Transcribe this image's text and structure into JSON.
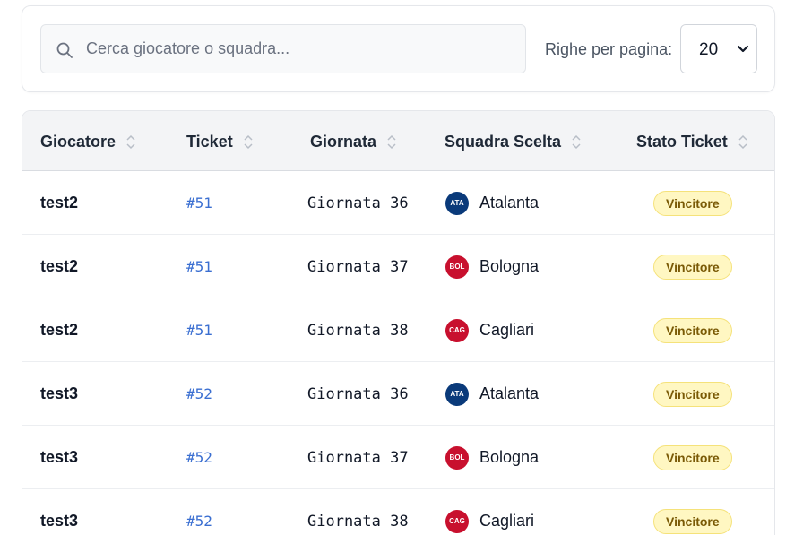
{
  "search": {
    "placeholder": "Cerca giocatore o squadra..."
  },
  "pagination": {
    "rows_label": "Righe per pagina:",
    "rows_value": "20"
  },
  "table": {
    "columns": [
      "Giocatore",
      "Ticket",
      "Giornata",
      "Squadra Scelta",
      "Stato Ticket"
    ],
    "rows": [
      {
        "player": "test2",
        "ticket": "#51",
        "round": "Giornata 36",
        "team": {
          "name": "Atalanta",
          "abbr": "ATA",
          "color": "#0a3a7a"
        },
        "status": "Vincitore"
      },
      {
        "player": "test2",
        "ticket": "#51",
        "round": "Giornata 37",
        "team": {
          "name": "Bologna",
          "abbr": "BOL",
          "color": "#c8102e"
        },
        "status": "Vincitore"
      },
      {
        "player": "test2",
        "ticket": "#51",
        "round": "Giornata 38",
        "team": {
          "name": "Cagliari",
          "abbr": "CAG",
          "color": "#c8102e"
        },
        "status": "Vincitore"
      },
      {
        "player": "test3",
        "ticket": "#52",
        "round": "Giornata 36",
        "team": {
          "name": "Atalanta",
          "abbr": "ATA",
          "color": "#0a3a7a"
        },
        "status": "Vincitore"
      },
      {
        "player": "test3",
        "ticket": "#52",
        "round": "Giornata 37",
        "team": {
          "name": "Bologna",
          "abbr": "BOL",
          "color": "#c8102e"
        },
        "status": "Vincitore"
      },
      {
        "player": "test3",
        "ticket": "#52",
        "round": "Giornata 38",
        "team": {
          "name": "Cagliari",
          "abbr": "CAG",
          "color": "#c8102e"
        },
        "status": "Vincitore"
      }
    ]
  },
  "colors": {
    "link": "#3b6fd1",
    "status_bg": "#fff7c2",
    "status_text": "#7a5a06"
  }
}
